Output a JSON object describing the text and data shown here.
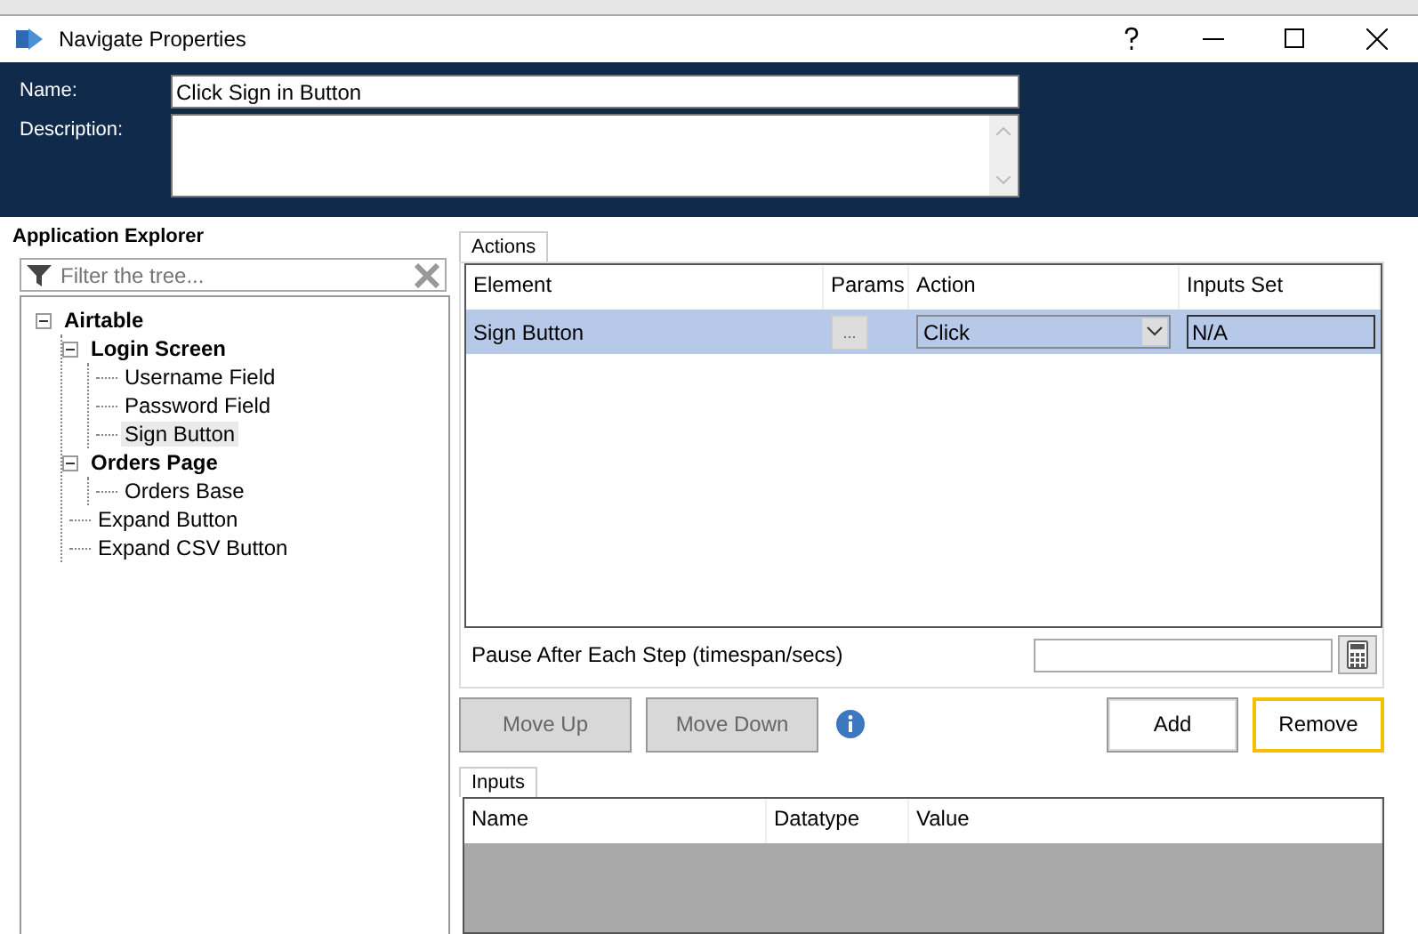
{
  "window": {
    "title": "Navigate Properties"
  },
  "header": {
    "name_label": "Name:",
    "name_value": "Click Sign in Button",
    "description_label": "Description:"
  },
  "explorer": {
    "title": "Application Explorer",
    "filter_placeholder": "Filter the tree...",
    "tree": [
      {
        "label": "Airtable",
        "bold": true,
        "expanded": true,
        "selected": false,
        "children": [
          {
            "label": "Login Screen",
            "bold": true,
            "expanded": true,
            "selected": false,
            "children": [
              {
                "label": "Username Field",
                "bold": false,
                "selected": false
              },
              {
                "label": "Password Field",
                "bold": false,
                "selected": false
              },
              {
                "label": "Sign Button",
                "bold": false,
                "selected": true
              }
            ]
          },
          {
            "label": "Orders Page",
            "bold": true,
            "expanded": true,
            "selected": false,
            "children": [
              {
                "label": "Orders Base",
                "bold": false,
                "selected": false
              }
            ]
          },
          {
            "label": "Expand Button",
            "bold": false,
            "selected": false
          },
          {
            "label": "Expand CSV Button",
            "bold": false,
            "selected": false
          }
        ]
      }
    ]
  },
  "actions": {
    "tab": "Actions",
    "columns": [
      "Element",
      "Params",
      "Action",
      "Inputs Set"
    ],
    "rows": [
      {
        "element": "Sign Button",
        "params": "...",
        "action": "Click",
        "inputs_set": "N/A",
        "selected": true
      }
    ],
    "pause_label": "Pause After Each Step (timespan/secs)"
  },
  "buttons": [
    {
      "label": "Move Up",
      "disabled": true,
      "focused": false
    },
    {
      "label": "Move Down",
      "disabled": true,
      "focused": false
    },
    {
      "label": "Add",
      "disabled": false,
      "focused": false
    },
    {
      "label": "Remove",
      "disabled": false,
      "focused": true
    }
  ],
  "inputs": {
    "tab": "Inputs",
    "columns": [
      "Name",
      "Datatype",
      "Value"
    ]
  }
}
